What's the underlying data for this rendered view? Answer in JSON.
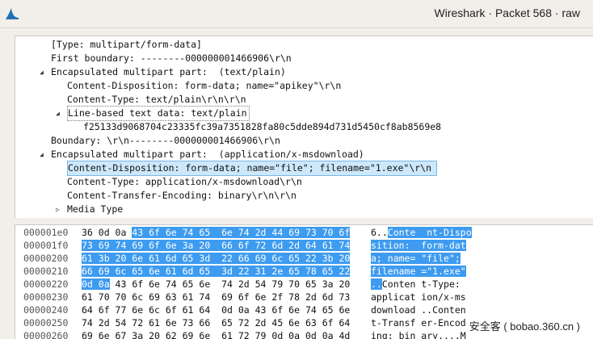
{
  "window": {
    "title": "Wireshark · Packet 568 · raw"
  },
  "tree": [
    {
      "text": "[Type: multipart/form-data]",
      "indent": 0,
      "toggle": "none"
    },
    {
      "text": "First boundary: --------000000001466906\\r\\n",
      "indent": 0,
      "toggle": "none"
    },
    {
      "text": "Encapsulated multipart part:  (text/plain)",
      "indent": 0,
      "toggle": "open"
    },
    {
      "text": "Content-Disposition: form-data; name=\"apikey\"\\r\\n",
      "indent": 1,
      "toggle": "none"
    },
    {
      "text": "Content-Type: text/plain\\r\\n\\r\\n",
      "indent": 1,
      "toggle": "none"
    },
    {
      "text": "Line-based text data: text/plain",
      "indent": 1,
      "toggle": "open",
      "boxed": true
    },
    {
      "text": "f25133d9068704c23335fc39a7351828fa80c5dde894d731d5450cf8ab8569e8",
      "indent": 2,
      "toggle": "none"
    },
    {
      "text": "Boundary: \\r\\n--------000000001466906\\r\\n",
      "indent": 0,
      "toggle": "none"
    },
    {
      "text": "Encapsulated multipart part:  (application/x-msdownload)",
      "indent": 0,
      "toggle": "open"
    },
    {
      "text": "Content-Disposition: form-data; name=\"file\"; filename=\"1.exe\"\\r\\n",
      "indent": 1,
      "toggle": "none",
      "selected": true
    },
    {
      "text": "Content-Type: application/x-msdownload\\r\\n",
      "indent": 1,
      "toggle": "none"
    },
    {
      "text": "Content-Transfer-Encoding: binary\\r\\n\\r\\n",
      "indent": 1,
      "toggle": "none"
    },
    {
      "text": "Media Type",
      "indent": 1,
      "toggle": "closed"
    }
  ],
  "hex": [
    {
      "offset": "000001e0",
      "hex_plain": "36 0d 0a ",
      "hex_hl": "43 6f 6e 74 65  6e 74 2d 44 69 73 70 6f",
      "hex_after": "",
      "ascii_plain": "6..",
      "ascii_hl": "Conte  nt-Dispo",
      "ascii_after": ""
    },
    {
      "offset": "000001f0",
      "hex_plain": "",
      "hex_hl": "73 69 74 69 6f 6e 3a 20  66 6f 72 6d 2d 64 61 74",
      "hex_after": "",
      "ascii_plain": "",
      "ascii_hl": "sition:  form-dat",
      "ascii_after": ""
    },
    {
      "offset": "00000200",
      "hex_plain": "",
      "hex_hl": "61 3b 20 6e 61 6d 65 3d  22 66 69 6c 65 22 3b 20",
      "hex_after": "",
      "ascii_plain": "",
      "ascii_hl": "a; name= \"file\";",
      "ascii_after": ""
    },
    {
      "offset": "00000210",
      "hex_plain": "",
      "hex_hl": "66 69 6c 65 6e 61 6d 65  3d 22 31 2e 65 78 65 22",
      "hex_after": "",
      "ascii_plain": "",
      "ascii_hl": "filename =\"1.exe\"",
      "ascii_after": ""
    },
    {
      "offset": "00000220",
      "hex_plain": "",
      "hex_hl": "0d 0a",
      "hex_after": " 43 6f 6e 74 65 6e  74 2d 54 79 70 65 3a 20",
      "ascii_plain": "",
      "ascii_hl": "..",
      "ascii_after": "Conten t-Type:"
    },
    {
      "offset": "00000230",
      "hex_plain": "61 70 70 6c 69 63 61 74  69 6f 6e 2f 78 2d 6d 73",
      "hex_hl": "",
      "hex_after": "",
      "ascii_plain": "applicat ion/x-ms",
      "ascii_hl": "",
      "ascii_after": ""
    },
    {
      "offset": "00000240",
      "hex_plain": "64 6f 77 6e 6c 6f 61 64  0d 0a 43 6f 6e 74 65 6e",
      "hex_hl": "",
      "hex_after": "",
      "ascii_plain": "download ..Conten",
      "ascii_hl": "",
      "ascii_after": ""
    },
    {
      "offset": "00000250",
      "hex_plain": "74 2d 54 72 61 6e 73 66  65 72 2d 45 6e 63 6f 64",
      "hex_hl": "",
      "hex_after": "",
      "ascii_plain": "t-Transf er-Encod",
      "ascii_hl": "",
      "ascii_after": ""
    },
    {
      "offset": "00000260",
      "hex_plain": "69 6e 67 3a 20 62 69 6e  61 72 79 0d 0a 0d 0a 4d",
      "hex_hl": "",
      "hex_after": "",
      "ascii_plain": "ing: bin ary....M",
      "ascii_hl": "",
      "ascii_after": ""
    }
  ],
  "watermark": {
    "text": "安全客 ( bobao.360.cn )"
  },
  "colors": {
    "selection_bg": "#cde8fb",
    "hex_highlight": "#3d9bf0"
  }
}
